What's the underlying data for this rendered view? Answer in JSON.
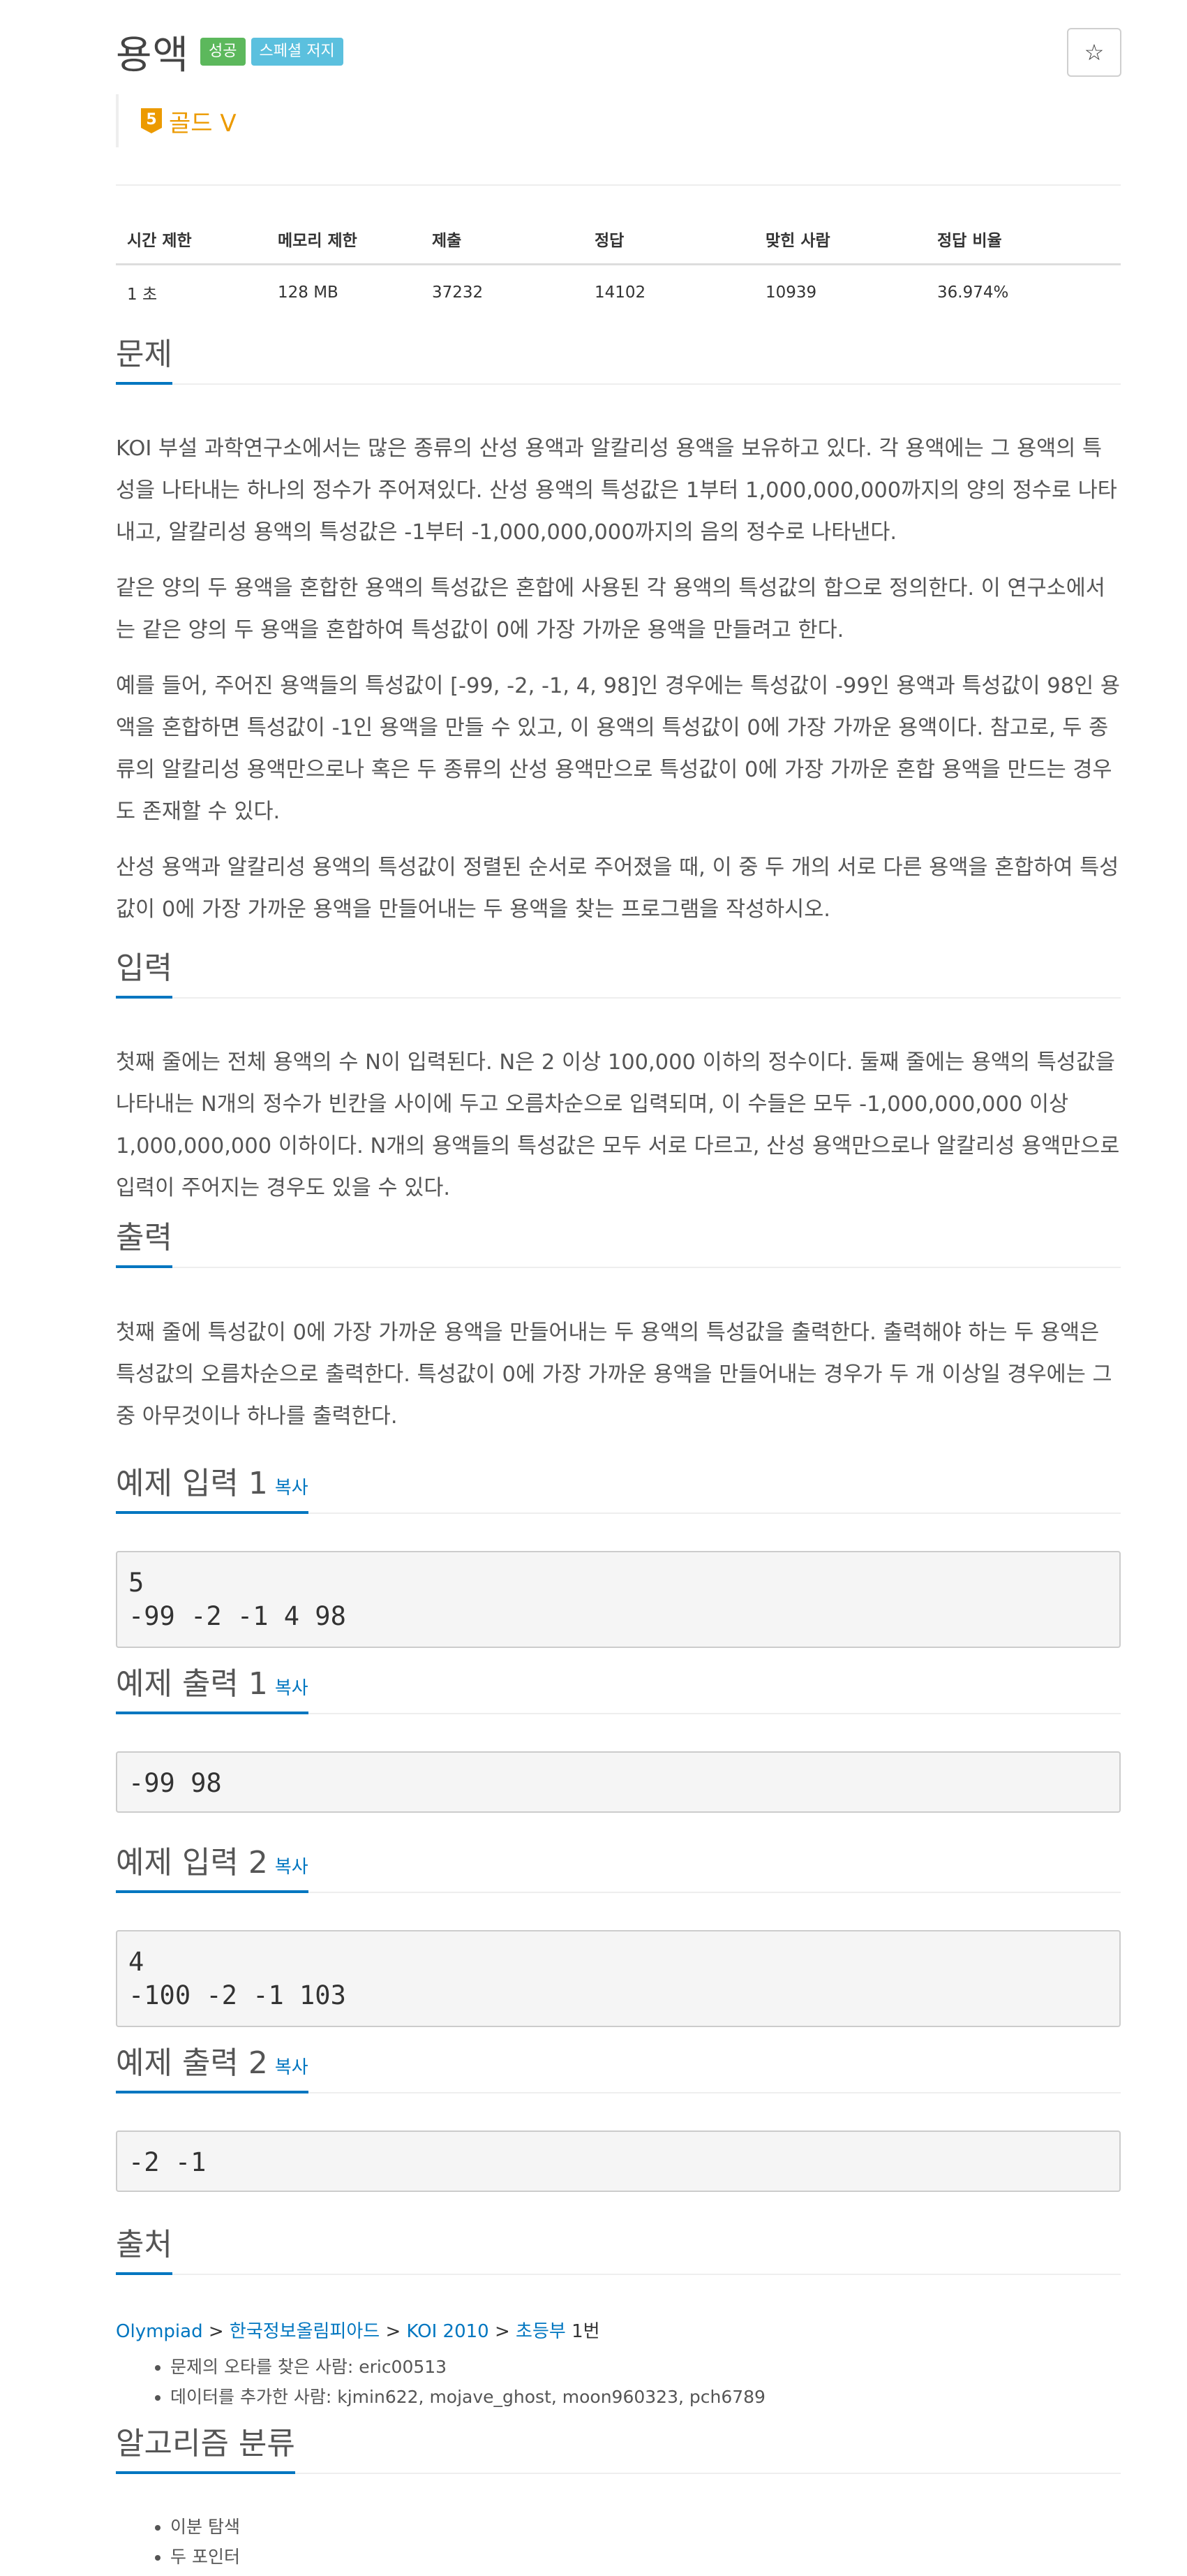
{
  "header": {
    "title": "용액",
    "labels": [
      "성공",
      "스페셜 저지"
    ],
    "star": "☆",
    "tier": "골드 V",
    "tier_num": "5",
    "tier_color": "#ec9a00"
  },
  "info_table": {
    "headers": [
      "시간 제한",
      "메모리 제한",
      "제출",
      "정답",
      "맞힌 사람",
      "정답 비율"
    ],
    "values": [
      "1 초",
      "128 MB",
      "37232",
      "14102",
      "10939",
      "36.974%"
    ]
  },
  "problem": {
    "heading": "문제",
    "paragraphs": [
      "KOI 부설 과학연구소에서는 많은 종류의 산성 용액과 알칼리성 용액을 보유하고 있다. 각 용액에는 그 용액의 특성을 나타내는 하나의 정수가 주어져있다. 산성 용액의 특성값은 1부터 1,000,000,000까지의 양의 정수로 나타내고, 알칼리성 용액의 특성값은 -1부터 -1,000,000,000까지의 음의 정수로 나타낸다.",
      "같은 양의 두 용액을 혼합한 용액의 특성값은 혼합에 사용된 각 용액의 특성값의 합으로 정의한다. 이 연구소에서는 같은 양의 두 용액을 혼합하여 특성값이 0에 가장 가까운 용액을 만들려고 한다.",
      "예를 들어, 주어진 용액들의 특성값이 [-99, -2, -1, 4, 98]인 경우에는 특성값이 -99인 용액과 특성값이 98인 용액을 혼합하면 특성값이 -1인 용액을 만들 수 있고, 이 용액의 특성값이 0에 가장 가까운 용액이다. 참고로, 두 종류의 알칼리성 용액만으로나 혹은 두 종류의 산성 용액만으로 특성값이 0에 가장 가까운 혼합 용액을 만드는 경우도 존재할 수 있다.",
      "산성 용액과 알칼리성 용액의 특성값이 정렬된 순서로 주어졌을 때, 이 중 두 개의 서로 다른 용액을 혼합하여 특성값이 0에 가장 가까운 용액을 만들어내는 두 용액을 찾는 프로그램을 작성하시오."
    ]
  },
  "input": {
    "heading": "입력",
    "text": "첫째 줄에는 전체 용액의 수 N이 입력된다. N은 2 이상 100,000 이하의 정수이다. 둘째 줄에는 용액의 특성값을 나타내는 N개의 정수가 빈칸을 사이에 두고 오름차순으로 입력되며, 이 수들은 모두 -1,000,000,000 이상 1,000,000,000 이하이다. N개의 용액들의 특성값은 모두 서로 다르고, 산성 용액만으로나 알칼리성 용액만으로 입력이 주어지는 경우도 있을 수 있다."
  },
  "output": {
    "heading": "출력",
    "text": "첫째 줄에 특성값이 0에 가장 가까운 용액을 만들어내는 두 용액의 특성값을 출력한다. 출력해야 하는 두 용액은 특성값의 오름차순으로 출력한다. 특성값이 0에 가장 가까운 용액을 만들어내는 경우가 두 개 이상일 경우에는 그 중 아무것이나 하나를 출력한다."
  },
  "samples": [
    {
      "heading": "예제 입력 1",
      "copy": "복사",
      "content": "5\n-99 -2 -1 4 98"
    },
    {
      "heading": "예제 출력 1",
      "copy": "복사",
      "content": "-99 98"
    },
    {
      "heading": "예제 입력 2",
      "copy": "복사",
      "content": "4\n-100 -2 -1 103"
    },
    {
      "heading": "예제 출력 2",
      "copy": "복사",
      "content": "-2 -1"
    }
  ],
  "source": {
    "heading": "출처",
    "links": [
      "Olympiad",
      "한국정보올림피아드",
      "KOI 2010",
      "초등부"
    ],
    "sep": " > ",
    "suffix": " 1번",
    "notes": [
      "문제의 오타를 찾은 사람: eric00513",
      "데이터를 추가한 사람: kjmin622, mojave_ghost, moon960323, pch6789"
    ]
  },
  "algorithm": {
    "heading": "알고리즘 분류",
    "items": [
      "이분 탐색",
      "두 포인터"
    ]
  }
}
